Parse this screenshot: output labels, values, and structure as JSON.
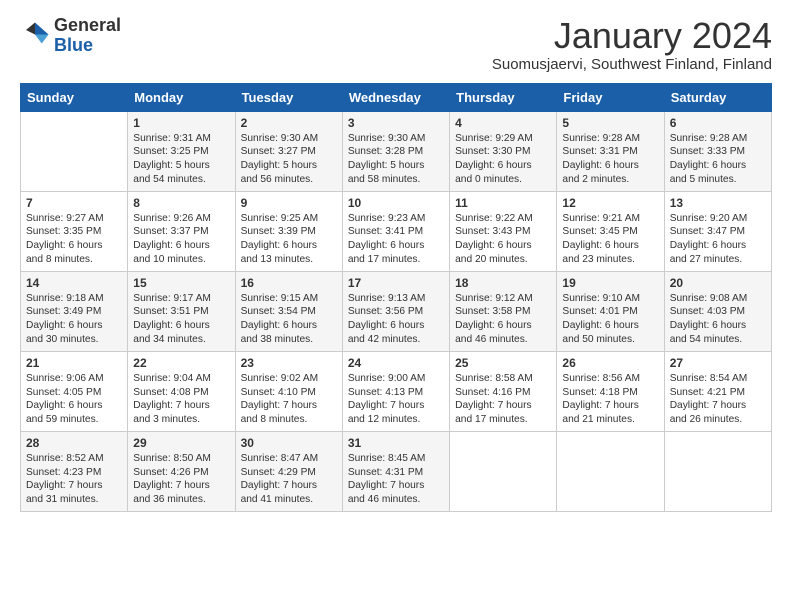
{
  "logo": {
    "general": "General",
    "blue": "Blue"
  },
  "title": "January 2024",
  "subtitle": "Suomusjaervi, Southwest Finland, Finland",
  "headers": [
    "Sunday",
    "Monday",
    "Tuesday",
    "Wednesday",
    "Thursday",
    "Friday",
    "Saturday"
  ],
  "weeks": [
    [
      {
        "day": "",
        "content": ""
      },
      {
        "day": "1",
        "content": "Sunrise: 9:31 AM\nSunset: 3:25 PM\nDaylight: 5 hours\nand 54 minutes."
      },
      {
        "day": "2",
        "content": "Sunrise: 9:30 AM\nSunset: 3:27 PM\nDaylight: 5 hours\nand 56 minutes."
      },
      {
        "day": "3",
        "content": "Sunrise: 9:30 AM\nSunset: 3:28 PM\nDaylight: 5 hours\nand 58 minutes."
      },
      {
        "day": "4",
        "content": "Sunrise: 9:29 AM\nSunset: 3:30 PM\nDaylight: 6 hours\nand 0 minutes."
      },
      {
        "day": "5",
        "content": "Sunrise: 9:28 AM\nSunset: 3:31 PM\nDaylight: 6 hours\nand 2 minutes."
      },
      {
        "day": "6",
        "content": "Sunrise: 9:28 AM\nSunset: 3:33 PM\nDaylight: 6 hours\nand 5 minutes."
      }
    ],
    [
      {
        "day": "7",
        "content": "Sunrise: 9:27 AM\nSunset: 3:35 PM\nDaylight: 6 hours\nand 8 minutes."
      },
      {
        "day": "8",
        "content": "Sunrise: 9:26 AM\nSunset: 3:37 PM\nDaylight: 6 hours\nand 10 minutes."
      },
      {
        "day": "9",
        "content": "Sunrise: 9:25 AM\nSunset: 3:39 PM\nDaylight: 6 hours\nand 13 minutes."
      },
      {
        "day": "10",
        "content": "Sunrise: 9:23 AM\nSunset: 3:41 PM\nDaylight: 6 hours\nand 17 minutes."
      },
      {
        "day": "11",
        "content": "Sunrise: 9:22 AM\nSunset: 3:43 PM\nDaylight: 6 hours\nand 20 minutes."
      },
      {
        "day": "12",
        "content": "Sunrise: 9:21 AM\nSunset: 3:45 PM\nDaylight: 6 hours\nand 23 minutes."
      },
      {
        "day": "13",
        "content": "Sunrise: 9:20 AM\nSunset: 3:47 PM\nDaylight: 6 hours\nand 27 minutes."
      }
    ],
    [
      {
        "day": "14",
        "content": "Sunrise: 9:18 AM\nSunset: 3:49 PM\nDaylight: 6 hours\nand 30 minutes."
      },
      {
        "day": "15",
        "content": "Sunrise: 9:17 AM\nSunset: 3:51 PM\nDaylight: 6 hours\nand 34 minutes."
      },
      {
        "day": "16",
        "content": "Sunrise: 9:15 AM\nSunset: 3:54 PM\nDaylight: 6 hours\nand 38 minutes."
      },
      {
        "day": "17",
        "content": "Sunrise: 9:13 AM\nSunset: 3:56 PM\nDaylight: 6 hours\nand 42 minutes."
      },
      {
        "day": "18",
        "content": "Sunrise: 9:12 AM\nSunset: 3:58 PM\nDaylight: 6 hours\nand 46 minutes."
      },
      {
        "day": "19",
        "content": "Sunrise: 9:10 AM\nSunset: 4:01 PM\nDaylight: 6 hours\nand 50 minutes."
      },
      {
        "day": "20",
        "content": "Sunrise: 9:08 AM\nSunset: 4:03 PM\nDaylight: 6 hours\nand 54 minutes."
      }
    ],
    [
      {
        "day": "21",
        "content": "Sunrise: 9:06 AM\nSunset: 4:05 PM\nDaylight: 6 hours\nand 59 minutes."
      },
      {
        "day": "22",
        "content": "Sunrise: 9:04 AM\nSunset: 4:08 PM\nDaylight: 7 hours\nand 3 minutes."
      },
      {
        "day": "23",
        "content": "Sunrise: 9:02 AM\nSunset: 4:10 PM\nDaylight: 7 hours\nand 8 minutes."
      },
      {
        "day": "24",
        "content": "Sunrise: 9:00 AM\nSunset: 4:13 PM\nDaylight: 7 hours\nand 12 minutes."
      },
      {
        "day": "25",
        "content": "Sunrise: 8:58 AM\nSunset: 4:16 PM\nDaylight: 7 hours\nand 17 minutes."
      },
      {
        "day": "26",
        "content": "Sunrise: 8:56 AM\nSunset: 4:18 PM\nDaylight: 7 hours\nand 21 minutes."
      },
      {
        "day": "27",
        "content": "Sunrise: 8:54 AM\nSunset: 4:21 PM\nDaylight: 7 hours\nand 26 minutes."
      }
    ],
    [
      {
        "day": "28",
        "content": "Sunrise: 8:52 AM\nSunset: 4:23 PM\nDaylight: 7 hours\nand 31 minutes."
      },
      {
        "day": "29",
        "content": "Sunrise: 8:50 AM\nSunset: 4:26 PM\nDaylight: 7 hours\nand 36 minutes."
      },
      {
        "day": "30",
        "content": "Sunrise: 8:47 AM\nSunset: 4:29 PM\nDaylight: 7 hours\nand 41 minutes."
      },
      {
        "day": "31",
        "content": "Sunrise: 8:45 AM\nSunset: 4:31 PM\nDaylight: 7 hours\nand 46 minutes."
      },
      {
        "day": "",
        "content": ""
      },
      {
        "day": "",
        "content": ""
      },
      {
        "day": "",
        "content": ""
      }
    ]
  ]
}
